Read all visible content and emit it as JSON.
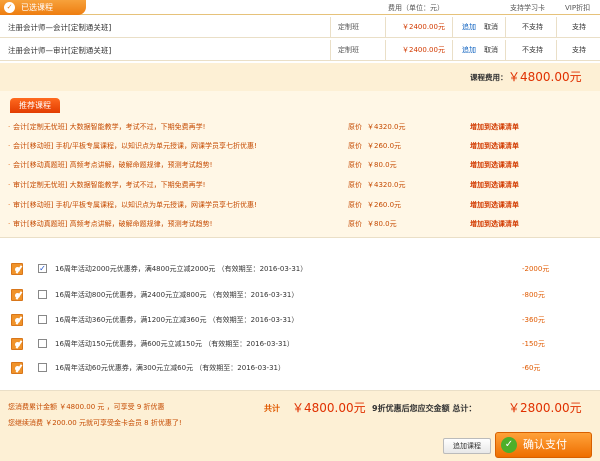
{
  "header": {
    "title": "已选课程",
    "col_fee": "费用（单位：元）",
    "col_card": "支持学习卡",
    "col_vip": "VIP折扣"
  },
  "cart": [
    {
      "name": "注册会计师—会计[定制通关班]",
      "type": "定制班",
      "price": "￥2400.00元",
      "add": "追加",
      "remove": "取消",
      "card": "不支持",
      "vip": "支持"
    },
    {
      "name": "注册会计师—审计[定制通关班]",
      "type": "定制班",
      "price": "￥2400.00元",
      "add": "追加",
      "remove": "取消",
      "card": "不支持",
      "vip": "支持"
    }
  ],
  "fee": {
    "label": "课程费用：",
    "value": "￥4800.00元"
  },
  "recommend": {
    "tag": "推荐课程",
    "price_label": "原价",
    "add_label": "增加到选课清单",
    "items": [
      {
        "name": "会计[定制无忧班] 大数据智能教学，考试不过，下期免费再学!",
        "price": "￥4320.0元"
      },
      {
        "name": "会计[移动班] 手机/平板专属课程，以知识点为单元授课，网课学员享七折优惠!",
        "price": "￥260.0元"
      },
      {
        "name": "会计[移动真题班] 高频考点讲解，破解命题规律，预测考试趋势!",
        "price": "￥80.0元"
      },
      {
        "name": "审计[定制无忧班] 大数据智能教学，考试不过，下期免费再学!",
        "price": "￥4320.0元"
      },
      {
        "name": "审计[移动班] 手机/平板专属课程，以知识点为单元授课，网课学员享七折优惠!",
        "price": "￥260.0元"
      },
      {
        "name": "审计[移动真题班] 高频考点讲解，破解命题规律，预测考试趋势!",
        "price": "￥80.0元"
      }
    ]
  },
  "coupons": [
    {
      "text": "16周年活动2000元优惠券，满4800元立减2000元 （有效期至：2016-03-31）",
      "amount": "-2000元",
      "checked": true
    },
    {
      "text": "16周年活动800元优惠券，满2400元立减800元 （有效期至：2016-03-31）",
      "amount": "-800元",
      "checked": false
    },
    {
      "text": "16周年活动360元优惠券，满1200元立减360元 （有效期至：2016-03-31）",
      "amount": "-360元",
      "checked": false
    },
    {
      "text": "16周年活动150元优惠券，满600元立减150元 （有效期至：2016-03-31）",
      "amount": "-150元",
      "checked": false
    },
    {
      "text": "16周年活动60元优惠券，满300元立减60元 （有效期至：2016-03-31）",
      "amount": "-60元",
      "checked": false
    }
  ],
  "footer": {
    "line1": "您消费累计金额 ￥4800.00 元 ，可享受 9 折优惠",
    "line2": "您继续消费 ￥200.00 元就可享受金卡会员 8 折优惠了!",
    "total_label": "共计",
    "total_value": "￥4800.00元",
    "discount_text": "9折优惠后您应交金额  总计：",
    "final_value": "￥2800.00元",
    "add_button": "追加课程",
    "pay_button": "确认支付"
  },
  "colors": {
    "accent": "#ee7d10",
    "price": "#e03000",
    "link": "#0a5fbf",
    "band": "#fdf0d5"
  }
}
